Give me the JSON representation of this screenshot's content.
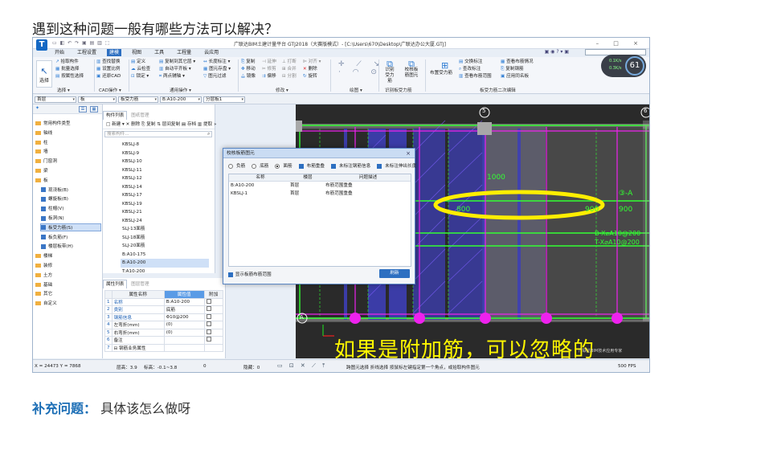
{
  "question": "遇到这种问题一般有哪些方法可以解决？",
  "app": {
    "logo": "T",
    "quick_access": "▭ ◧ ↶ ↷ ▣ ▤ ▥ ⬚",
    "title": "广联达BIM土建计量平台 GTJ2018（大赛版模式）- [C:\\Users\\670\\Desktop\\广联达办公大厦.GTJ]",
    "window_buttons": "– □ ×",
    "right_icons": "▣ ◉ ? ▾ ▣",
    "menu": [
      "开始",
      "工程设置",
      "建模",
      "视图",
      "工具",
      "工程量",
      "云应用"
    ],
    "active_menu_index": 2
  },
  "ribbon": {
    "select": {
      "icon": "↖",
      "label": "选择"
    },
    "col1": [
      "拾取构件",
      "批量选择",
      "按属性选择"
    ],
    "col2": [
      "查找替换",
      "设置比例",
      "还原CAD"
    ],
    "col3": [
      "定义",
      "云检查",
      "锁定 ▾"
    ],
    "col4": [
      "复制到其它层 ▾",
      "自动平齐板 ▾",
      "两点辅轴 ▾"
    ],
    "col5": [
      "长度标注 ▾",
      "图元存盘 ▾",
      "图元过滤"
    ],
    "col6": [
      "复制",
      "移动",
      "镜像"
    ],
    "col7": [
      "延伸",
      "修剪",
      "偏移"
    ],
    "col8": [
      "打断",
      "合并",
      "分割"
    ],
    "col9": [
      "对齐 ▾",
      "删除",
      "旋转"
    ],
    "col10": [
      "识别受力筋",
      "校核板筋图元"
    ],
    "col11": [
      "布置受力筋"
    ],
    "col12": [
      "交换标注",
      "查改标注",
      "查看布筋范围"
    ],
    "col13": [
      "查看布筋情况",
      "复制钢筋",
      "应用同名板"
    ],
    "groups": [
      "选择 ▾",
      "CAD操作 ▾",
      "通用操作 ▾",
      "修改 ▾",
      "绘图 ▾",
      "识别板受力筋",
      "板受力筋二次编辑"
    ],
    "gauge": {
      "line1": "0.1K/s",
      "line2": "0.3K/s",
      "value": "61"
    }
  },
  "selector_bar": {
    "floor": "首层",
    "type": "板",
    "subtype": "板受力筋",
    "component": "B:A10-200",
    "layer": "分层板1"
  },
  "nav_tree": {
    "items": [
      {
        "label": "常用构件类型",
        "level": 0
      },
      {
        "label": "轴线",
        "level": 0
      },
      {
        "label": "柱",
        "level": 0
      },
      {
        "label": "墙",
        "level": 0
      },
      {
        "label": "门窗洞",
        "level": 0
      },
      {
        "label": "梁",
        "level": 0
      },
      {
        "label": "板",
        "level": 0
      },
      {
        "label": "现浇板(B)",
        "level": 1
      },
      {
        "label": "螺旋板(B)",
        "level": 1
      },
      {
        "label": "柱帽(V)",
        "level": 1
      },
      {
        "label": "板洞(N)",
        "level": 1
      },
      {
        "label": "板受力筋(S)",
        "level": 1,
        "selected": true
      },
      {
        "label": "板负筋(F)",
        "level": 1
      },
      {
        "label": "楼层板带(H)",
        "level": 1
      },
      {
        "label": "楼梯",
        "level": 0
      },
      {
        "label": "装修",
        "level": 0
      },
      {
        "label": "土方",
        "level": 0
      },
      {
        "label": "基础",
        "level": 0
      },
      {
        "label": "其它",
        "level": 0
      },
      {
        "label": "自定义",
        "level": 0
      }
    ]
  },
  "component_panel": {
    "tabs": [
      "构件列表",
      "图纸管理"
    ],
    "toolbar": "□ 新建 ▾  ✕ 删除  ⎘ 复制  ⇅ 层间复制  ▤ 存档  ▥ 提取  »",
    "search_placeholder": "搜索构件...",
    "items": [
      "KBSLJ-8",
      "KBSLJ-9",
      "KBSLJ-10",
      "KBSLJ-11",
      "KBSLJ-12",
      "KBSLJ-14",
      "KBSLJ-17",
      "KBSLJ-19",
      "KBSLJ-21",
      "KBSLJ-24",
      "SLJ-13面筋",
      "SLJ-18面筋",
      "SLJ-20面筋",
      "B:A10-175",
      "B:A10-200",
      "T:A10-200"
    ],
    "selected_index": 14
  },
  "property_panel": {
    "tabs": [
      "属性列表",
      "图层管理"
    ],
    "headers": [
      "属性名称",
      "属性值",
      "附加"
    ],
    "rows": [
      {
        "n": "1",
        "name": "名称",
        "value": "B:A10-200"
      },
      {
        "n": "2",
        "name": "类别",
        "value": "底筋"
      },
      {
        "n": "3",
        "name": "钢筋信息",
        "value": "Φ10@200"
      },
      {
        "n": "4",
        "name": "左弯折(mm)",
        "value": "(0)"
      },
      {
        "n": "5",
        "name": "右弯折(mm)",
        "value": "(0)"
      },
      {
        "n": "6",
        "name": "备注",
        "value": ""
      },
      {
        "n": "7",
        "name": "⊟ 钢筋业务属性",
        "value": ""
      }
    ]
  },
  "dialog": {
    "title": "校核板筋图元",
    "close": "×",
    "options": [
      {
        "kind": "radio",
        "label": "负筋",
        "on": false
      },
      {
        "kind": "radio",
        "label": "底筋",
        "on": false
      },
      {
        "kind": "radio",
        "label": "面筋",
        "on": true
      },
      {
        "kind": "check",
        "label": "布筋重叠"
      },
      {
        "kind": "check",
        "label": "未标注钢筋信息"
      },
      {
        "kind": "check",
        "label": "未标注伸出长度"
      }
    ],
    "headers": [
      "名称",
      "楼层",
      "问题描述"
    ],
    "rows": [
      {
        "name": "B:A10-200",
        "floor": "首层",
        "desc": "布筋范围重叠"
      },
      {
        "name": "KBSLJ-1",
        "floor": "首层",
        "desc": "布筋范围重叠"
      }
    ],
    "footer_check": "显示板筋布筋范围",
    "refresh": "刷新"
  },
  "canvas": {
    "axis_top": "5",
    "axis_right": "6",
    "axis_bottom": "A",
    "labels": [
      "1000",
      "800",
      "900",
      "900",
      "B-X⌀A10@200",
      "T-X⌀A10@200",
      "③-A",
      "900"
    ],
    "subtitle": "如果是附加筋，可以忽略的",
    "watermark": "广联达BIM技术应用专家"
  },
  "status_bar": {
    "coords": "X = 24473 Y = 7868",
    "floor_height": "层高：3.9",
    "elevation": "标高：-0.1~3.8",
    "zero": "0",
    "hidden": "隐藏：0",
    "hint": "跨图元选择  折线选择  按鼠标左键指定第一个角点，或拾取构件图元",
    "fps": "500 FPS"
  },
  "supplement": {
    "label": "补充问题：",
    "text": "具体该怎么做呀"
  },
  "colors": {
    "accent": "#2d6fc1",
    "canvas_bg": "#2a2a2a",
    "rebar_green": "#33ff33",
    "axis_magenta": "#ee22ee",
    "highlight_yellow": "#fff700"
  }
}
